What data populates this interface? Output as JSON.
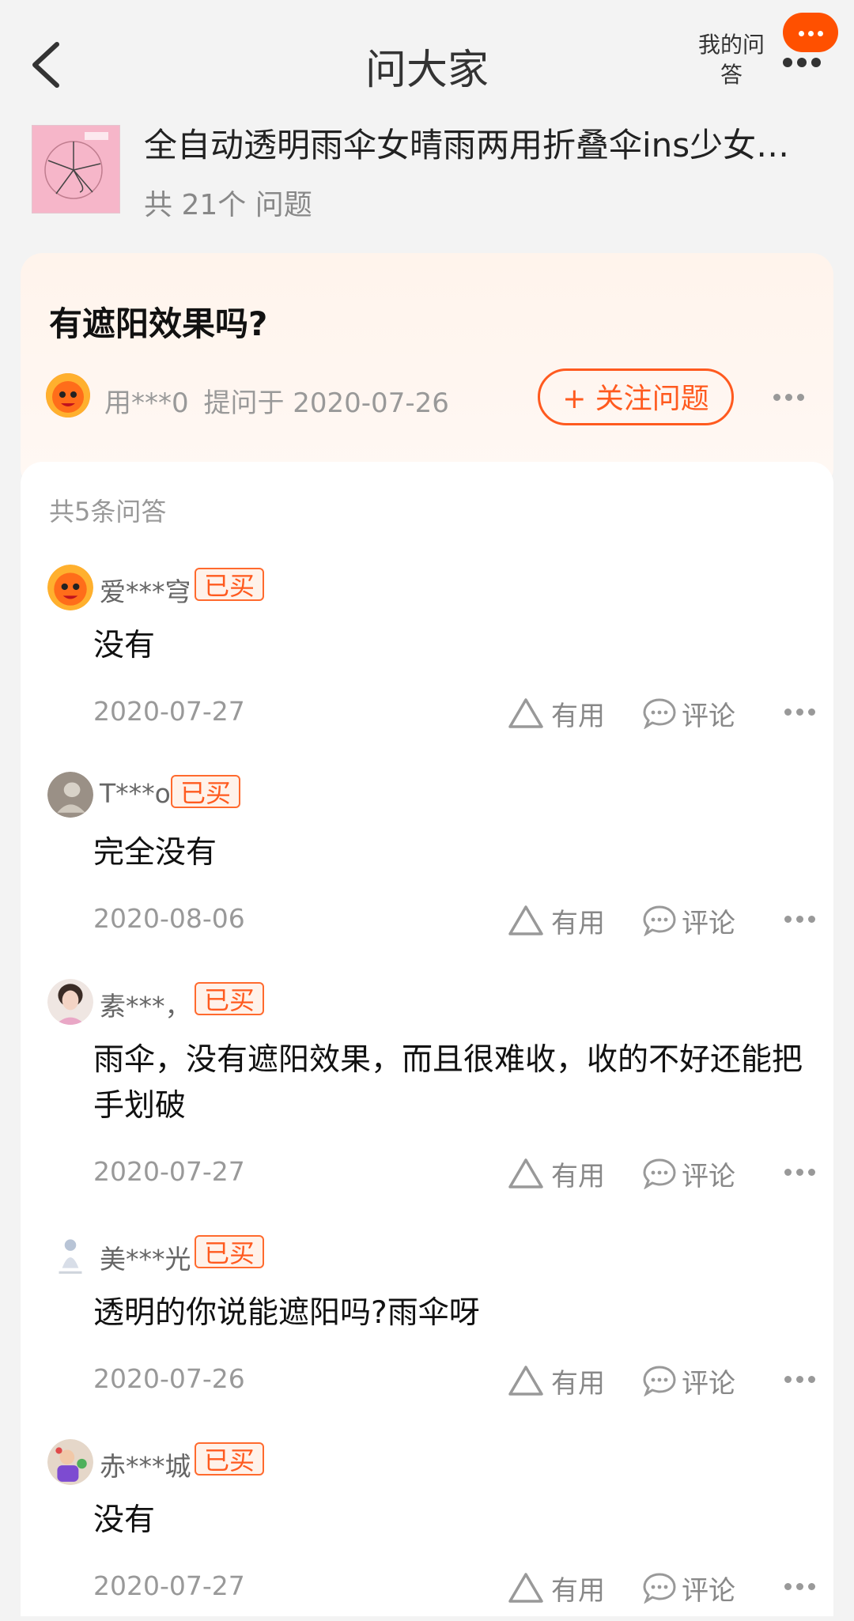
{
  "header": {
    "title": "问大家",
    "my_answers": "我的问答"
  },
  "product": {
    "title": "全自动透明雨伞女晴雨两用折叠伞ins少女…",
    "question_count": "共 21个 问题"
  },
  "question": {
    "text": "有遮阳效果吗?",
    "asker": "用***0",
    "asked_label": "提问于 2020-07-26",
    "follow_label": "+ 关注问题"
  },
  "answers_header": "共5条问答",
  "answers": [
    {
      "user": "爱***穹",
      "tag": "已买",
      "text": "没有",
      "date": "2020-07-27"
    },
    {
      "user": "T***o",
      "tag": "已买",
      "text": "完全没有",
      "date": "2020-08-06"
    },
    {
      "user": "素***，",
      "tag": "已买",
      "text": "雨伞，没有遮阳效果，而且很难收，收的不好还能把手划破",
      "date": "2020-07-27"
    },
    {
      "user": "美***光",
      "tag": "已买",
      "text": "透明的你说能遮阳吗?雨伞呀",
      "date": "2020-07-26"
    },
    {
      "user": "赤***城",
      "tag": "已买",
      "text": "没有",
      "date": "2020-07-27"
    }
  ],
  "action_labels": {
    "useful": "有用",
    "comment": "评论"
  },
  "colors": {
    "accent": "#ff5a1f",
    "badge_bg": "#fff2ea",
    "question_bg": "#fff4ec"
  }
}
